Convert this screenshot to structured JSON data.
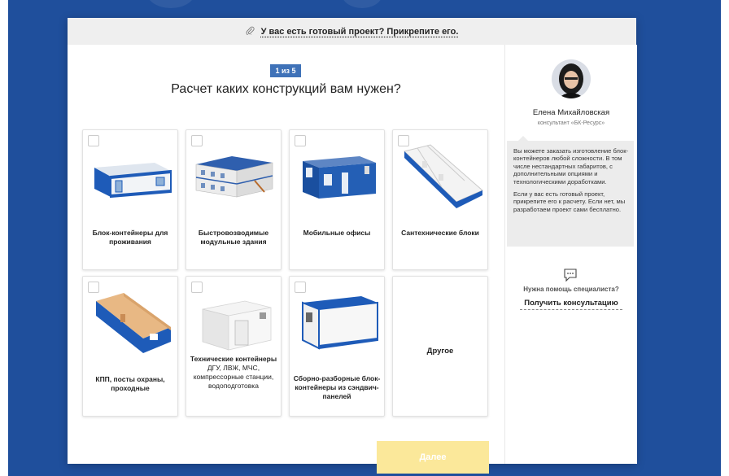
{
  "topbar": {
    "icon": "paperclip-icon",
    "text": "У вас есть готовый проект? Прикрепите его."
  },
  "step": {
    "label": "1 из 5"
  },
  "question": "Расчет каких конструкций вам нужен?",
  "cards": [
    {
      "label": "Блок-контейнеры для проживания"
    },
    {
      "label": "Быстровозводимые модульные здания"
    },
    {
      "label": "Мобильные офисы"
    },
    {
      "label": "Сантехнические блоки"
    },
    {
      "label": "КПП, посты охраны, проходные"
    },
    {
      "title": "Технические контейнеры",
      "subtitle": "ДГУ, ЛВЖ, МЧС, компрессорные станции, водоподготовка"
    },
    {
      "label": "Сборно-разборные блок-контейнеры из сэндвич-панелей"
    },
    {
      "label": "Другое"
    }
  ],
  "next_button": {
    "label": "Далее"
  },
  "consultant": {
    "name": "Елена Михайловская",
    "role": "консультант «БК-Ресурс»",
    "message_1": "Вы можете заказать изготовление блок-контейнеров любой сложности. В том числе нестандартных габаритов, с дополнительными опциями и технологическими доработками.",
    "message_2": "Если у вас есть готовый проект, прикрепите его к расчету. Если нет, мы разработаем проект сами бесплатно.",
    "help_text": "Нужна помощь специалиста?",
    "consult_link": "Получить консультацию"
  },
  "colors": {
    "background": "#1f4f9c",
    "step_badge": "#3f72b8",
    "next_button": "#fbe89a",
    "container_blue": "#1e5bb8"
  }
}
